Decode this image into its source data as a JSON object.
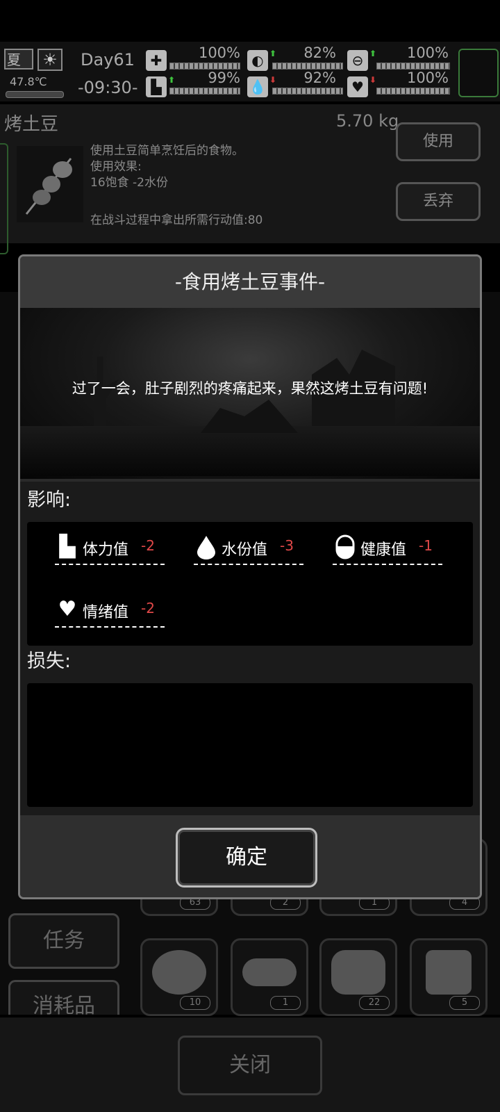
{
  "status": {
    "season": "夏",
    "temperature": "47.8℃",
    "day": "Day61",
    "time": "-09:30-",
    "stats": [
      {
        "name": "health-kit",
        "icon": "first-aid-icon",
        "value": "100%",
        "trend": ""
      },
      {
        "name": "hunger",
        "icon": "stomach-icon",
        "value": "82%",
        "trend": "up"
      },
      {
        "name": "medicine",
        "icon": "pill-icon",
        "value": "100%",
        "trend": "up"
      },
      {
        "name": "stamina",
        "icon": "boot-icon",
        "value": "99%",
        "trend": "up"
      },
      {
        "name": "water",
        "icon": "water-drop-icon",
        "value": "92%",
        "trend": "down"
      },
      {
        "name": "mood",
        "icon": "heart-icon",
        "value": "100%",
        "trend": "down"
      }
    ]
  },
  "item": {
    "name": "烤土豆",
    "weight": "5.70 kg",
    "description": "使用土豆简单烹饪后的食物。\n使用效果:\n16饱食 -2水份",
    "combat_cost": "在战斗过程中拿出所需行动值:80",
    "use_label": "使用",
    "discard_label": "丢弃"
  },
  "inventory": {
    "categories": [
      "任务",
      "消耗品"
    ],
    "visible_counts_row1": [
      "63",
      "2",
      "1",
      "4"
    ],
    "visible_counts_row2": [
      "10",
      "1",
      "22",
      "5"
    ],
    "close_label": "关闭"
  },
  "modal": {
    "title": "-食用烤土豆事件-",
    "scene_text": "过了一会，肚子剧烈的疼痛起来，果然这烤土豆有问题!",
    "effects_label": "影响:",
    "effects": [
      {
        "label": "体力值",
        "value": "-2",
        "icon": "boot-icon"
      },
      {
        "label": "水份值",
        "value": "-3",
        "icon": "water-drop-icon"
      },
      {
        "label": "健康值",
        "value": "-1",
        "icon": "pill-icon"
      },
      {
        "label": "情绪值",
        "value": "-2",
        "icon": "heart-icon"
      }
    ],
    "loss_label": "损失:",
    "confirm_label": "确定"
  },
  "colors": {
    "negative": "#e04848",
    "positive_arrow": "#3ec33e",
    "negative_arrow": "#d03a3a",
    "accent_green": "#3a7a3a"
  }
}
